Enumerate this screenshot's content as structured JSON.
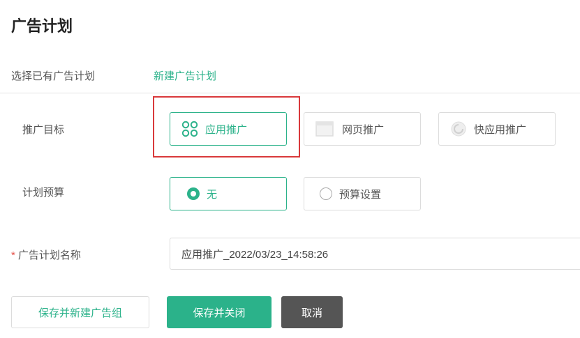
{
  "page": {
    "title": "广告计划"
  },
  "tabs": {
    "existing": "选择已有广告计划",
    "new": "新建广告计划"
  },
  "goal": {
    "label": "推广目标",
    "options": [
      {
        "label": "应用推广",
        "icon": "grid-icon",
        "selected": true
      },
      {
        "label": "网页推广",
        "icon": "webpage-icon",
        "selected": false
      },
      {
        "label": "快应用推广",
        "icon": "quick-app-icon",
        "selected": false
      }
    ]
  },
  "budget": {
    "label": "计划预算",
    "options": [
      {
        "label": "无",
        "selected": true
      },
      {
        "label": "预算设置",
        "selected": false
      }
    ]
  },
  "name": {
    "required_mark": "*",
    "label": "广告计划名称",
    "value": "应用推广_2022/03/23_14:58:26"
  },
  "actions": {
    "save_new_group": "保存并新建广告组",
    "save_close": "保存并关闭",
    "cancel": "取消"
  },
  "colors": {
    "accent": "#2bb28a",
    "highlight": "#d9393b",
    "cancel_bg": "#555555",
    "required": "#e5534b"
  }
}
